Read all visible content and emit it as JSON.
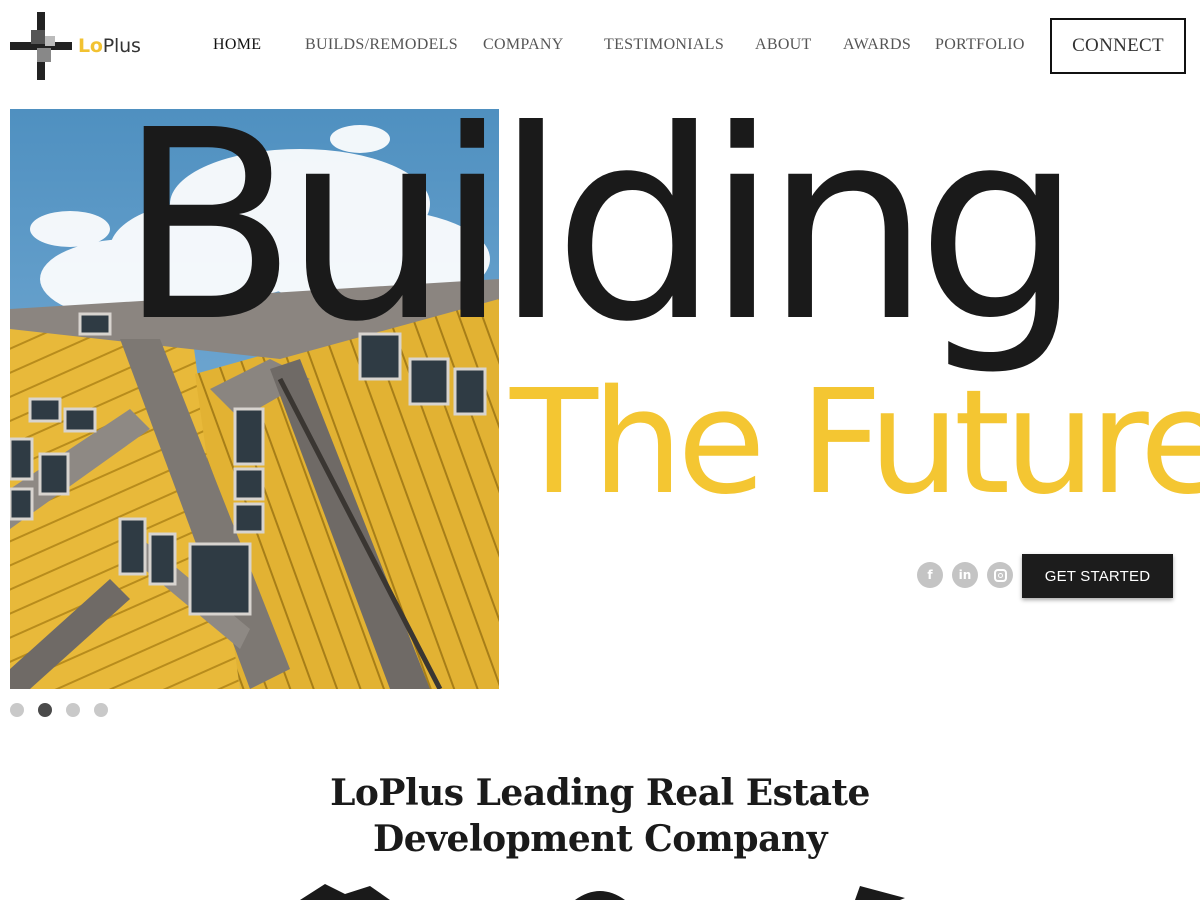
{
  "brand": {
    "logo_lo": "Lo",
    "logo_plus": "Plus"
  },
  "nav": {
    "items": [
      {
        "label": "HOME",
        "active": true
      },
      {
        "label": "BUILDS/REMODELS"
      },
      {
        "label": "COMPANY"
      },
      {
        "label": "TESTIMONIALS"
      },
      {
        "label": "ABOUT"
      },
      {
        "label": "AWARDS"
      },
      {
        "label": "PORTFOLIO"
      }
    ],
    "connect_label": "CONNECT"
  },
  "hero": {
    "headline": "Building",
    "subline": "The Future",
    "cta_label": "GET STARTED",
    "image_icon": "yellow-cube-houses-photo",
    "socials": [
      {
        "name": "facebook",
        "icon": "facebook-icon",
        "glyph": "f"
      },
      {
        "name": "linkedin",
        "icon": "linkedin-icon",
        "glyph": "in"
      },
      {
        "name": "instagram",
        "icon": "instagram-icon",
        "glyph": ""
      }
    ],
    "slides": {
      "count": 4,
      "active_index": 1
    }
  },
  "section": {
    "title_line1": "LoPlus Leading Real Estate",
    "title_line2": "Development Company"
  },
  "colors": {
    "accent": "#f4c632",
    "text": "#1a1a1a",
    "button_bg": "#1c1c1c",
    "dot_inactive": "#c9c9c9",
    "dot_active": "#4a4a4a"
  }
}
